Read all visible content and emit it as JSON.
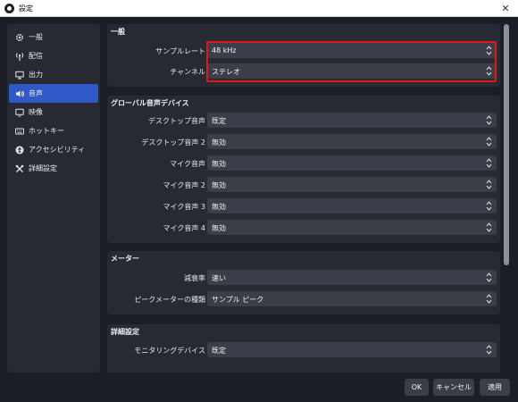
{
  "window": {
    "title": "設定",
    "close_glyph": "✕"
  },
  "sidebar": {
    "items": [
      {
        "label": "一般",
        "icon": "gear-icon"
      },
      {
        "label": "配信",
        "icon": "broadcast-icon"
      },
      {
        "label": "出力",
        "icon": "output-icon"
      },
      {
        "label": "音声",
        "icon": "speaker-icon",
        "active": true
      },
      {
        "label": "映像",
        "icon": "monitor-icon"
      },
      {
        "label": "ホットキー",
        "icon": "keyboard-icon"
      },
      {
        "label": "アクセシビリティ",
        "icon": "accessibility-icon"
      },
      {
        "label": "詳細設定",
        "icon": "tools-icon"
      }
    ]
  },
  "general": {
    "title": "一般",
    "sample_rate": {
      "label": "サンプルレート",
      "value": "48 kHz"
    },
    "channels": {
      "label": "チャンネル",
      "value": "ステレオ"
    }
  },
  "global_audio": {
    "title": "グローバル音声デバイス",
    "rows": [
      {
        "label": "デスクトップ音声",
        "value": "既定"
      },
      {
        "label": "デスクトップ音声 2",
        "value": "無効"
      },
      {
        "label": "マイク音声",
        "value": "無効"
      },
      {
        "label": "マイク音声 2",
        "value": "無効"
      },
      {
        "label": "マイク音声 3",
        "value": "無効"
      },
      {
        "label": "マイク音声 4",
        "value": "無効"
      }
    ]
  },
  "meters": {
    "title": "メーター",
    "decay": {
      "label": "減衰率",
      "value": "速い"
    },
    "peak_meter": {
      "label": "ピークメーターの種類",
      "value": "サンプル ピーク"
    }
  },
  "advanced": {
    "title": "詳細設定",
    "row": {
      "label": "モニタリングデバイス",
      "value": "既定"
    }
  },
  "buttons": {
    "ok": "OK",
    "cancel": "キャンセル",
    "apply": "適用"
  },
  "colors": {
    "accent": "#2f59c7",
    "highlight": "#e01818",
    "panel": "#272a33",
    "background": "#1b1e26"
  }
}
